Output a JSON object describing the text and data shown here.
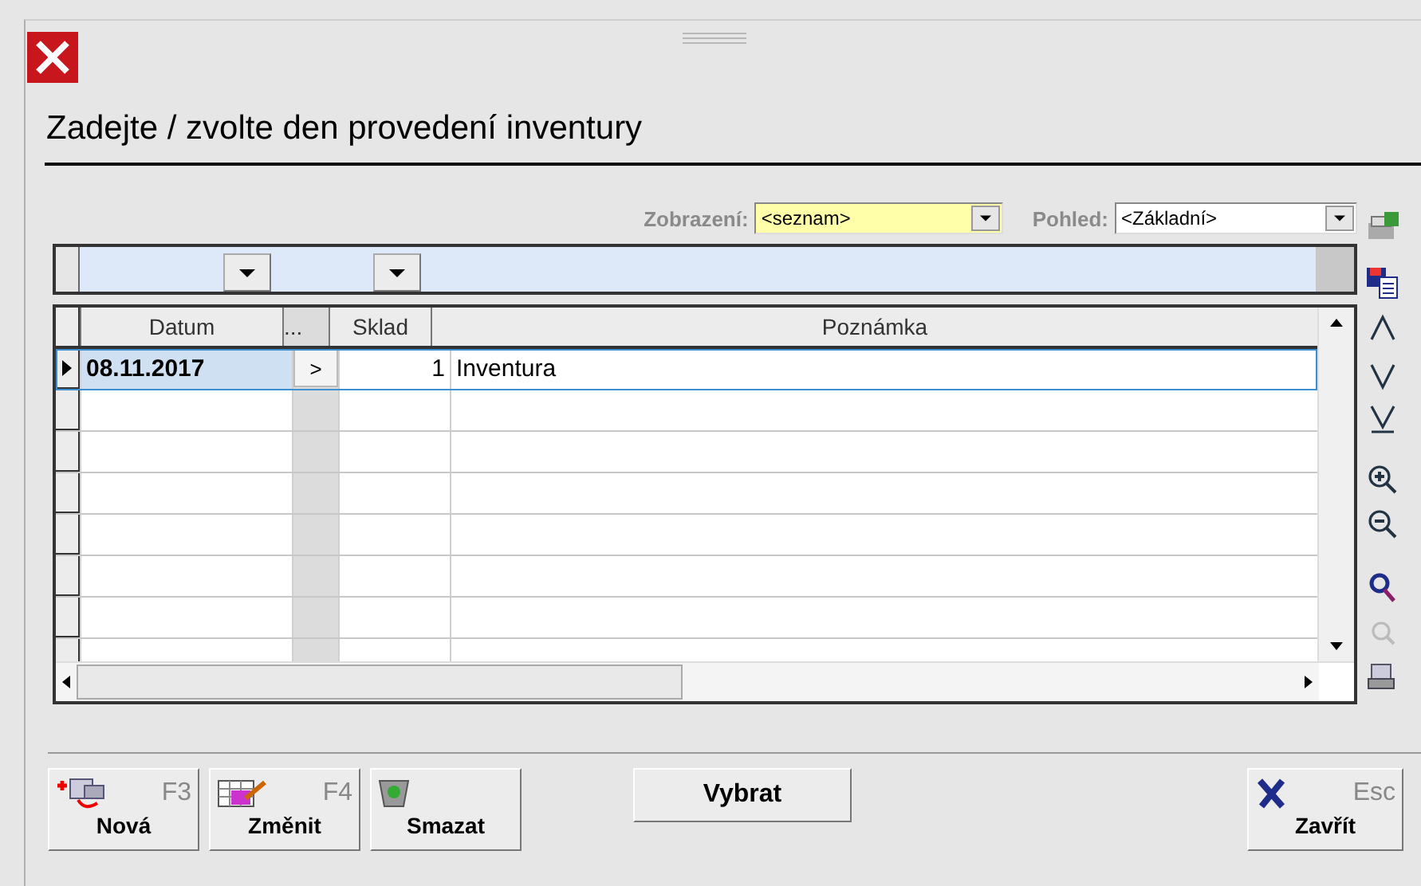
{
  "window": {
    "title": "Zadejte / zvolte den provedení inventury"
  },
  "toolbar": {
    "display": {
      "label": "Zobrazení:",
      "value": "<seznam>"
    },
    "view": {
      "label": "Pohled:",
      "value": "<Základní>"
    }
  },
  "grid": {
    "columns": [
      "Datum",
      "...",
      "Sklad",
      "Poznámka"
    ],
    "rows": [
      {
        "datum": "08.11.2017",
        "more": ">",
        "sklad": "1",
        "note": "Inventura",
        "selected": true
      }
    ]
  },
  "buttons": [
    {
      "kind": "new",
      "label": "Nová",
      "key": "F3"
    },
    {
      "kind": "edit",
      "label": "Změnit",
      "key": "F4"
    },
    {
      "kind": "delete",
      "label": "Smazat"
    },
    {
      "kind": "plain",
      "label": "Vybrat"
    },
    {
      "kind": "close",
      "label": "Zavřít",
      "key": "Esc"
    }
  ]
}
